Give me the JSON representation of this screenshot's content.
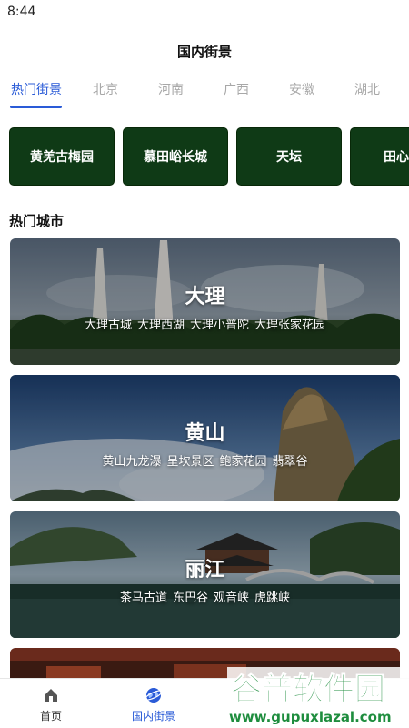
{
  "status": {
    "time": "8:44"
  },
  "header": {
    "title": "国内街景"
  },
  "tabs": [
    {
      "label": "热门街景",
      "active": true
    },
    {
      "label": "北京",
      "active": false
    },
    {
      "label": "河南",
      "active": false
    },
    {
      "label": "广西",
      "active": false
    },
    {
      "label": "安徽",
      "active": false
    },
    {
      "label": "湖北",
      "active": false
    }
  ],
  "chips": [
    "黄羌古梅园",
    "慕田峪长城",
    "天坛",
    "田心镇"
  ],
  "hot_cities": {
    "title": "热门城市",
    "cards": [
      {
        "name": "大理",
        "spots": [
          "大理古城",
          "大理西湖",
          "大理小普陀",
          "大理张家花园"
        ]
      },
      {
        "name": "黄山",
        "spots": [
          "黄山九龙瀑",
          "呈坎景区",
          "鲍家花园",
          "翡翠谷"
        ]
      },
      {
        "name": "丽江",
        "spots": [
          "茶马古道",
          "东巴谷",
          "观音峡",
          "虎跳峡"
        ]
      }
    ]
  },
  "bottom_nav": [
    {
      "label": "首页",
      "icon": "home-icon",
      "active": false
    },
    {
      "label": "国内街景",
      "icon": "globe-icon",
      "active": true
    }
  ],
  "watermark": {
    "brand": "谷普软件园",
    "url": "www.gupuxlazal.com"
  },
  "colors": {
    "accent": "#2a5bd7",
    "chip_bg": "#0f3a16"
  }
}
